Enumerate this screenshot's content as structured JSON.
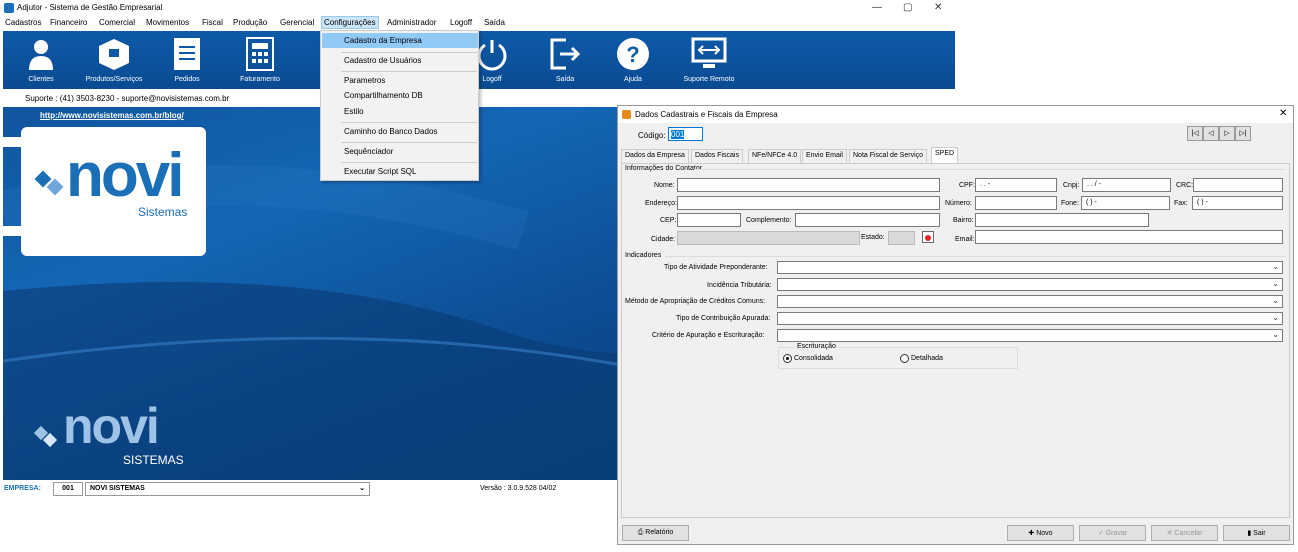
{
  "window": {
    "title": "Adjutor - Sistema de Gestão Empresarial",
    "min": "—",
    "max": "▢",
    "close": "✕"
  },
  "menu": [
    "Cadastros",
    "Financeiro",
    "Comercial",
    "Movimentos",
    "Fiscal",
    "Produção",
    "Gerencial",
    "Configurações",
    "Administrador",
    "Logoff",
    "Saída"
  ],
  "toolbar": [
    {
      "label": "Clientes",
      "icon": "user-icon"
    },
    {
      "label": "Produtos/Serviços",
      "icon": "box-icon"
    },
    {
      "label": "Pedidos",
      "icon": "list-icon"
    },
    {
      "label": "Faturamento",
      "icon": "calculator-icon"
    },
    {
      "label": "Logoff",
      "icon": "power-icon"
    },
    {
      "label": "Saída",
      "icon": "exit-icon"
    },
    {
      "label": "Ajuda",
      "icon": "help-icon"
    },
    {
      "label": "Suporte Remoto",
      "icon": "remote-icon"
    }
  ],
  "support": "Suporte : (41) 3503-8230 - suporte@novisistemas.com.br",
  "blog": "http://www.novisistemas.com.br/blog/",
  "logo": {
    "top": "novi",
    "sub": "Sistemas",
    "bottom": "novi",
    "bottom_sub": "SISTEMAS"
  },
  "status": {
    "empresa_label": "EMPRESA:",
    "code": "001",
    "name": "NOVI SISTEMAS",
    "version": "Versão : 3.0.9.528 04/02"
  },
  "dropdown": [
    "Cadastro da Empresa",
    "Cadastro de Usuários",
    "Parametros",
    "Compartilhamento DB",
    "Estilo",
    "Caminho do Banco Dados",
    "Sequênciador",
    "Executar Script SQL"
  ],
  "dialog": {
    "title": "Dados Cadastrais e Fiscais da Empresa",
    "codigo_label": "Código:",
    "codigo": "001",
    "tabs": [
      "Dados da Empresa",
      "Dados Fiscais",
      "NFe/NFCe 4.0",
      "Envio Email",
      "Nota Fiscal de Serviço",
      "SPED"
    ],
    "contador_title": "Informações do Contator",
    "labels": {
      "nome": "Nome:",
      "cpf": "CPF:",
      "cnpj": "Cnpj:",
      "crc": "CRC:",
      "endereco": "Endereço:",
      "numero": "Número:",
      "fone": "Fone:",
      "fax": "Fax:",
      "cep": "CEP:",
      "complemento": "Complemento:",
      "bairro": "Bairro:",
      "cidade": "Cidade:",
      "estado": "Estado:",
      "email": "Email:"
    },
    "masks": {
      "cpf": " .   .   -",
      "cnpj": " .   .   /   -",
      "fone": "(  )    -",
      "fax": "(  )    -"
    },
    "indicadores_title": "Indicadores",
    "indicadores": [
      "Tipo de Atividade Preponderante:",
      "Incidência Tributária:",
      "Método de Apropriação de Créditos Comuns:",
      "Tipo de Contribuição Apurada:",
      "Critério de Apuração e Escrituração:"
    ],
    "escrituracao": {
      "title": "Escrituração",
      "opt1": "Consolidada",
      "opt2": "Detalhada"
    },
    "buttons": {
      "relatorio": "Relatório",
      "novo": "Novo",
      "gravar": "Gravar",
      "cancelar": "Cancelar",
      "sair": "Sair"
    }
  },
  "colors": {
    "blue": "#0d5aa8",
    "accent": "#e8232a",
    "highlight": "#91c9f7"
  }
}
